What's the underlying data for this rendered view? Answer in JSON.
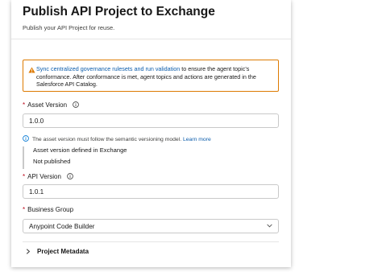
{
  "header": {
    "title": "Publish API Project to Exchange",
    "subtitle": "Publish your API Project for reuse."
  },
  "warning": {
    "icon": "warning-icon",
    "link_text": "Sync centralized governance rulesets and run validation",
    "text_after_link": " to ensure the agent topic's conformance. After conformance is met, agent topics and actions are generated in the Salesforce API Catalog."
  },
  "form": {
    "required_marker": "*",
    "asset_version": {
      "label": "Asset Version",
      "value": "1.0.0",
      "help_text": "The asset version must follow the semantic versioning model.",
      "help_link": "Learn more"
    },
    "asset_defined": {
      "heading": "Asset version defined in Exchange",
      "value": "Not published"
    },
    "api_version": {
      "label": "API Version",
      "value": "1.0.1"
    },
    "business_group": {
      "label": "Business Group",
      "selected": "Anypoint Code Builder"
    }
  },
  "project_metadata": {
    "label": "Project Metadata"
  },
  "colors": {
    "warning_border": "#dd7a01",
    "link": "#0b5cab",
    "required": "#ba0517"
  }
}
